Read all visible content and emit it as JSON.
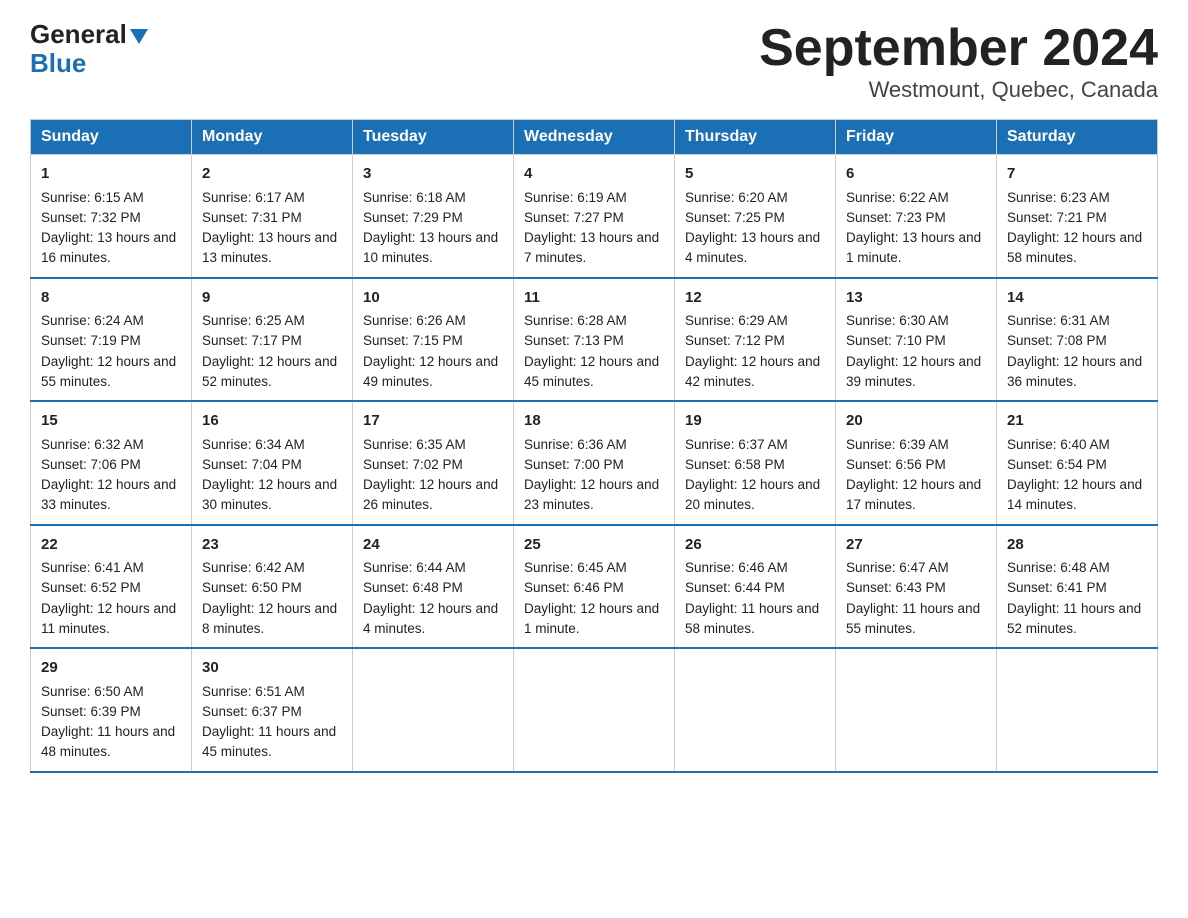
{
  "header": {
    "logo_general": "General",
    "logo_blue": "Blue",
    "title": "September 2024",
    "subtitle": "Westmount, Quebec, Canada"
  },
  "columns": [
    "Sunday",
    "Monday",
    "Tuesday",
    "Wednesday",
    "Thursday",
    "Friday",
    "Saturday"
  ],
  "weeks": [
    [
      {
        "day": "1",
        "sunrise": "6:15 AM",
        "sunset": "7:32 PM",
        "daylight": "13 hours and 16 minutes."
      },
      {
        "day": "2",
        "sunrise": "6:17 AM",
        "sunset": "7:31 PM",
        "daylight": "13 hours and 13 minutes."
      },
      {
        "day": "3",
        "sunrise": "6:18 AM",
        "sunset": "7:29 PM",
        "daylight": "13 hours and 10 minutes."
      },
      {
        "day": "4",
        "sunrise": "6:19 AM",
        "sunset": "7:27 PM",
        "daylight": "13 hours and 7 minutes."
      },
      {
        "day": "5",
        "sunrise": "6:20 AM",
        "sunset": "7:25 PM",
        "daylight": "13 hours and 4 minutes."
      },
      {
        "day": "6",
        "sunrise": "6:22 AM",
        "sunset": "7:23 PM",
        "daylight": "13 hours and 1 minute."
      },
      {
        "day": "7",
        "sunrise": "6:23 AM",
        "sunset": "7:21 PM",
        "daylight": "12 hours and 58 minutes."
      }
    ],
    [
      {
        "day": "8",
        "sunrise": "6:24 AM",
        "sunset": "7:19 PM",
        "daylight": "12 hours and 55 minutes."
      },
      {
        "day": "9",
        "sunrise": "6:25 AM",
        "sunset": "7:17 PM",
        "daylight": "12 hours and 52 minutes."
      },
      {
        "day": "10",
        "sunrise": "6:26 AM",
        "sunset": "7:15 PM",
        "daylight": "12 hours and 49 minutes."
      },
      {
        "day": "11",
        "sunrise": "6:28 AM",
        "sunset": "7:13 PM",
        "daylight": "12 hours and 45 minutes."
      },
      {
        "day": "12",
        "sunrise": "6:29 AM",
        "sunset": "7:12 PM",
        "daylight": "12 hours and 42 minutes."
      },
      {
        "day": "13",
        "sunrise": "6:30 AM",
        "sunset": "7:10 PM",
        "daylight": "12 hours and 39 minutes."
      },
      {
        "day": "14",
        "sunrise": "6:31 AM",
        "sunset": "7:08 PM",
        "daylight": "12 hours and 36 minutes."
      }
    ],
    [
      {
        "day": "15",
        "sunrise": "6:32 AM",
        "sunset": "7:06 PM",
        "daylight": "12 hours and 33 minutes."
      },
      {
        "day": "16",
        "sunrise": "6:34 AM",
        "sunset": "7:04 PM",
        "daylight": "12 hours and 30 minutes."
      },
      {
        "day": "17",
        "sunrise": "6:35 AM",
        "sunset": "7:02 PM",
        "daylight": "12 hours and 26 minutes."
      },
      {
        "day": "18",
        "sunrise": "6:36 AM",
        "sunset": "7:00 PM",
        "daylight": "12 hours and 23 minutes."
      },
      {
        "day": "19",
        "sunrise": "6:37 AM",
        "sunset": "6:58 PM",
        "daylight": "12 hours and 20 minutes."
      },
      {
        "day": "20",
        "sunrise": "6:39 AM",
        "sunset": "6:56 PM",
        "daylight": "12 hours and 17 minutes."
      },
      {
        "day": "21",
        "sunrise": "6:40 AM",
        "sunset": "6:54 PM",
        "daylight": "12 hours and 14 minutes."
      }
    ],
    [
      {
        "day": "22",
        "sunrise": "6:41 AM",
        "sunset": "6:52 PM",
        "daylight": "12 hours and 11 minutes."
      },
      {
        "day": "23",
        "sunrise": "6:42 AM",
        "sunset": "6:50 PM",
        "daylight": "12 hours and 8 minutes."
      },
      {
        "day": "24",
        "sunrise": "6:44 AM",
        "sunset": "6:48 PM",
        "daylight": "12 hours and 4 minutes."
      },
      {
        "day": "25",
        "sunrise": "6:45 AM",
        "sunset": "6:46 PM",
        "daylight": "12 hours and 1 minute."
      },
      {
        "day": "26",
        "sunrise": "6:46 AM",
        "sunset": "6:44 PM",
        "daylight": "11 hours and 58 minutes."
      },
      {
        "day": "27",
        "sunrise": "6:47 AM",
        "sunset": "6:43 PM",
        "daylight": "11 hours and 55 minutes."
      },
      {
        "day": "28",
        "sunrise": "6:48 AM",
        "sunset": "6:41 PM",
        "daylight": "11 hours and 52 minutes."
      }
    ],
    [
      {
        "day": "29",
        "sunrise": "6:50 AM",
        "sunset": "6:39 PM",
        "daylight": "11 hours and 48 minutes."
      },
      {
        "day": "30",
        "sunrise": "6:51 AM",
        "sunset": "6:37 PM",
        "daylight": "11 hours and 45 minutes."
      },
      null,
      null,
      null,
      null,
      null
    ]
  ],
  "labels": {
    "sunrise": "Sunrise:",
    "sunset": "Sunset:",
    "daylight": "Daylight:"
  }
}
